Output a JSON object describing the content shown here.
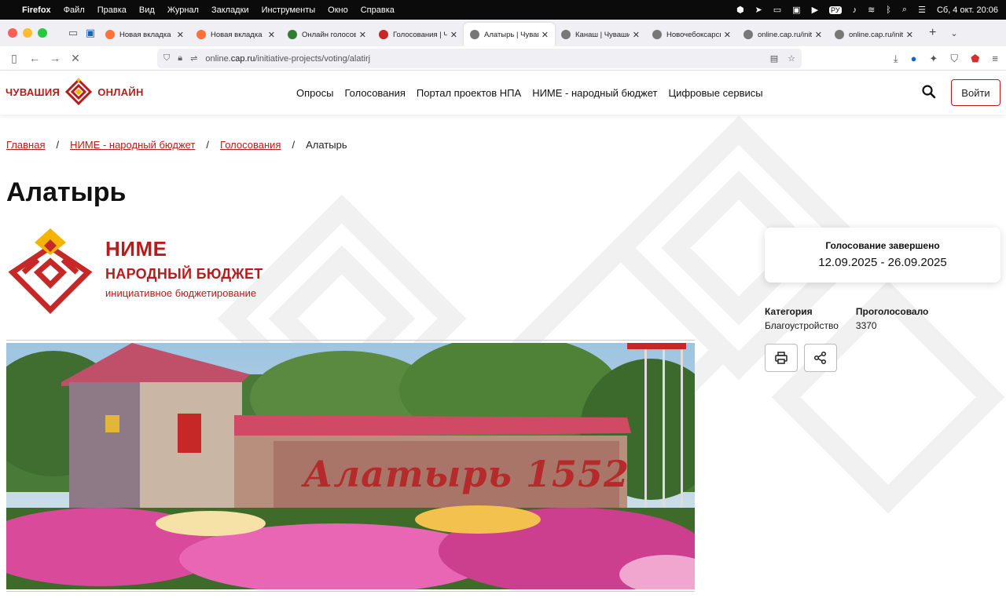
{
  "menubar": {
    "app": "Firefox",
    "items": [
      "Файл",
      "Правка",
      "Вид",
      "Журнал",
      "Закладки",
      "Инструменты",
      "Окно",
      "Справка"
    ],
    "datetime": "Сб, 4 окт.  20:06",
    "lang": "РУ"
  },
  "tabs": [
    {
      "title": "Новая вкладка",
      "color": "#ff7139"
    },
    {
      "title": "Новая вкладка",
      "color": "#ff7139"
    },
    {
      "title": "Онлайн голосован",
      "color": "#2e7d32"
    },
    {
      "title": "Голосования | Чув",
      "color": "#c62828"
    },
    {
      "title": "Алатырь | Чуваши",
      "color": "#777777"
    },
    {
      "title": "Канаш | Чувашия",
      "color": "#777777"
    },
    {
      "title": "Новочебоксарск |",
      "color": "#777777"
    },
    {
      "title": "online.cap.ru/initia",
      "color": "#777777"
    },
    {
      "title": "online.cap.ru/initia",
      "color": "#777777"
    }
  ],
  "url": {
    "prefix": "online.",
    "domain": "cap.ru",
    "path": "/initiative-projects/voting/alatirj"
  },
  "site": {
    "logo_left": "ЧУВАШИЯ",
    "logo_right": "ОНЛАЙН",
    "nav": [
      "Опросы",
      "Голосования",
      "Портал проектов НПА",
      "НИМЕ - народный бюджет",
      "Цифровые сервисы"
    ],
    "login": "Войти"
  },
  "breadcrumb": [
    {
      "label": "Главная",
      "link": true
    },
    {
      "label": "НИМЕ - народный бюджет",
      "link": true
    },
    {
      "label": "Голосования",
      "link": true
    },
    {
      "label": "Алатырь",
      "link": false
    }
  ],
  "page": {
    "title": "Алатырь",
    "nime_title": "НИМЕ",
    "nime_subtitle": "НАРОДНЫЙ БЮДЖЕТ",
    "nime_caption": "инициативное бюджетирование",
    "photo_sign": "Алатырь 1552"
  },
  "status": {
    "title": "Голосование завершено",
    "dates": "12.09.2025 - 26.09.2025"
  },
  "meta": {
    "category_label": "Категория",
    "category_value": "Благоустройство",
    "votes_label": "Проголосовало",
    "votes_value": "3370"
  },
  "colors": {
    "brand": "#b71c1c",
    "accent_yellow": "#f4b400"
  }
}
